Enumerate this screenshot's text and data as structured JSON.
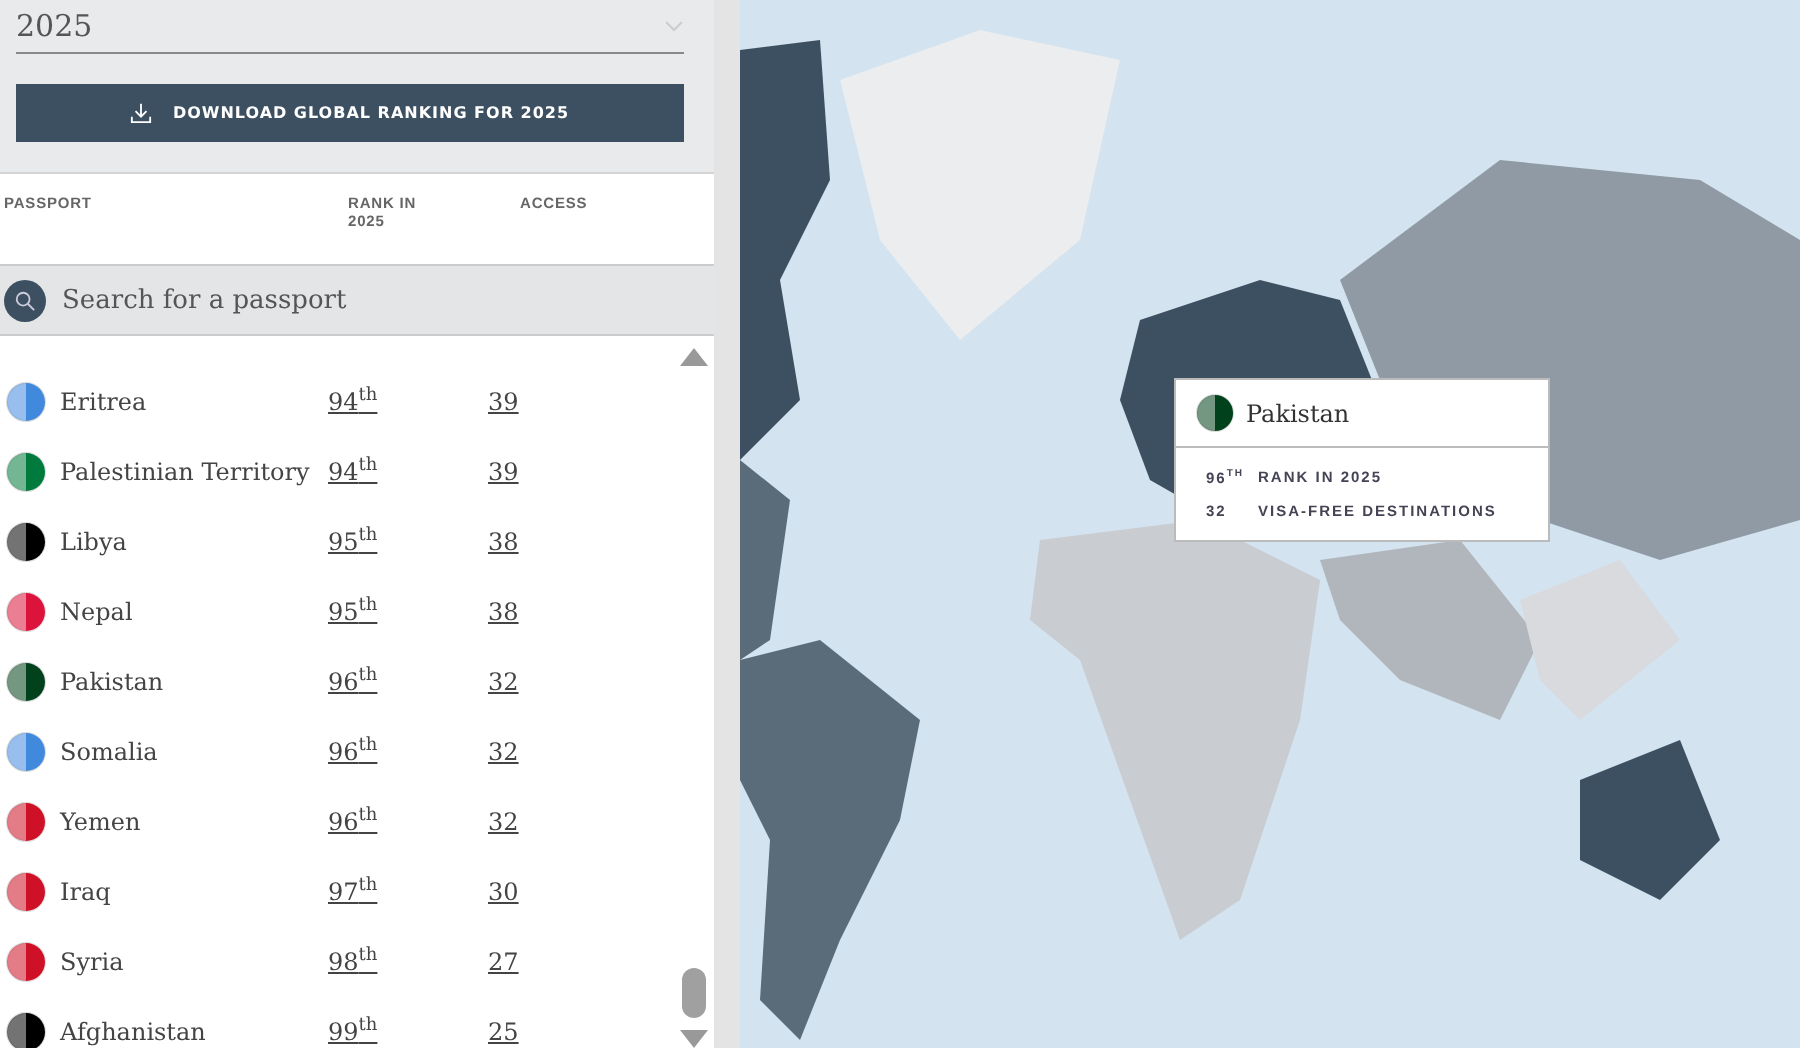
{
  "year_select": {
    "value": "2025"
  },
  "download_button": {
    "label": "DOWNLOAD GLOBAL RANKING FOR 2025"
  },
  "table": {
    "columns": [
      "PASSPORT",
      "RANK IN 2025",
      "ACCESS"
    ],
    "search": {
      "placeholder": "Search for a passport"
    },
    "rows": [
      {
        "country": "Eritrea",
        "rank": "94$^{th}$",
        "access": "39",
        "color": "#4189dd"
      },
      {
        "country": "Palestinian Territory",
        "rank": "94$^{th}$",
        "access": "39",
        "color": "#007a3d"
      },
      {
        "country": "Libya",
        "rank": "95$^{th}$",
        "access": "38",
        "color": "#000000"
      },
      {
        "country": "Nepal",
        "rank": "95$^{th}$",
        "access": "38",
        "color": "#dc143c"
      },
      {
        "country": "Pakistan",
        "rank": "96$^{th}$",
        "access": "32",
        "color": "#01411c"
      },
      {
        "country": "Somalia",
        "rank": "96$^{th}$",
        "access": "32",
        "color": "#4189dd"
      },
      {
        "country": "Yemen",
        "rank": "96$^{th}$",
        "access": "32",
        "color": "#ce1126"
      },
      {
        "country": "Iraq",
        "rank": "97$^{th}$",
        "access": "30",
        "color": "#ce1126"
      },
      {
        "country": "Syria",
        "rank": "98$^{th}$",
        "access": "27",
        "color": "#ce1126"
      },
      {
        "country": "Afghanistan",
        "rank": "99$^{th}$",
        "access": "25",
        "color": "#000000"
      }
    ]
  },
  "map_tooltip": {
    "country": "Pakistan",
    "color": "#01411c",
    "lines": [
      {
        "value": "96$^{TH}$",
        "label": "RANK IN 2025"
      },
      {
        "value": "32",
        "label": "VISA-FREE DESTINATIONS"
      }
    ]
  }
}
